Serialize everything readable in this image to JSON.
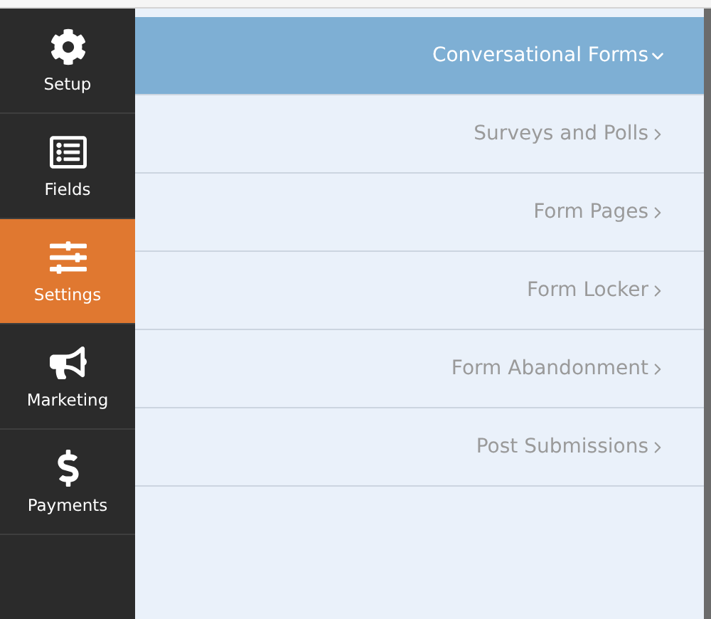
{
  "sidebar": {
    "items": [
      {
        "label": "Setup",
        "selected": false
      },
      {
        "label": "Fields",
        "selected": false
      },
      {
        "label": "Settings",
        "selected": true
      },
      {
        "label": "Marketing",
        "selected": false
      },
      {
        "label": "Payments",
        "selected": false
      }
    ]
  },
  "sections": [
    {
      "label": "Conversational Forms",
      "expanded": true
    },
    {
      "label": "Surveys and Polls",
      "expanded": false
    },
    {
      "label": "Form Pages",
      "expanded": false
    },
    {
      "label": "Form Locker",
      "expanded": false
    },
    {
      "label": "Form Abandonment",
      "expanded": false
    },
    {
      "label": "Post Submissions",
      "expanded": false
    }
  ]
}
